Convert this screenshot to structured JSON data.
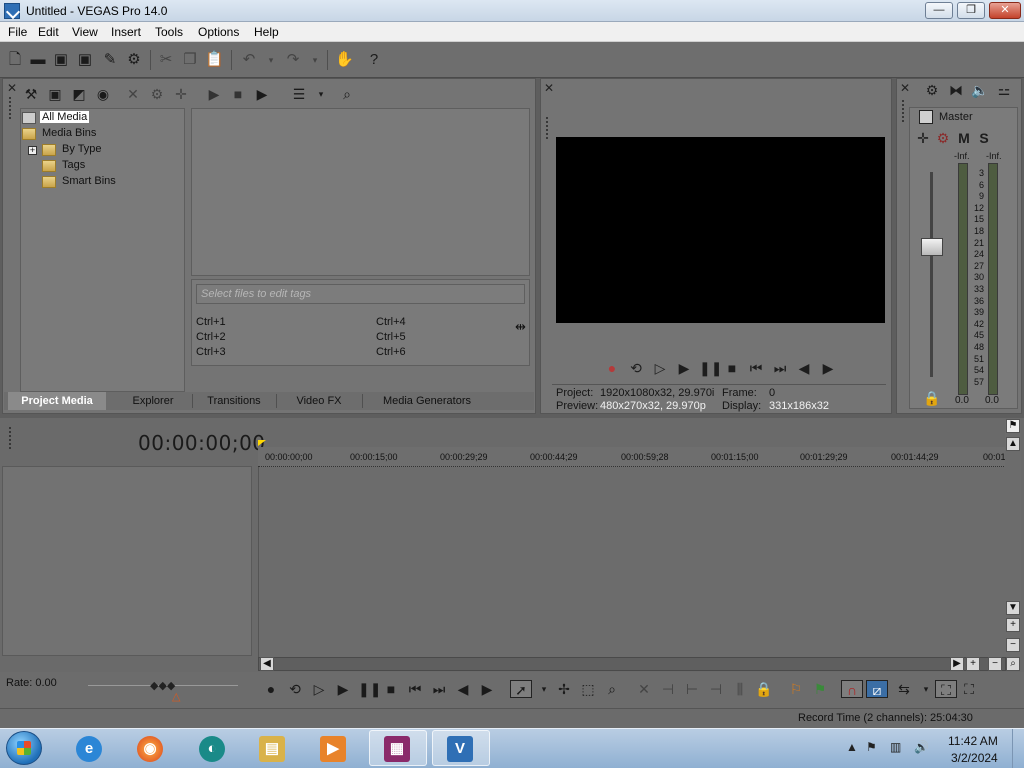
{
  "window": {
    "title": "Untitled - VEGAS Pro 14.0",
    "minimize": "—",
    "maximize": "❐",
    "close": "✕"
  },
  "menu": [
    "File",
    "Edit",
    "View",
    "Insert",
    "Tools",
    "Options",
    "Help"
  ],
  "project_media": {
    "tree": [
      "All Media",
      "Media Bins",
      "By Type",
      "Tags",
      "Smart Bins"
    ],
    "tag_placeholder": "Select files to edit tags",
    "shortcuts": [
      "Ctrl+1",
      "Ctrl+2",
      "Ctrl+3",
      "Ctrl+4",
      "Ctrl+5",
      "Ctrl+6"
    ],
    "expander": "+"
  },
  "tabs": [
    "Project Media",
    "Explorer",
    "Transitions",
    "Video FX",
    "Media Generators"
  ],
  "preview": {
    "project_label": "Project:",
    "project_value": "1920x1080x32, 29.970i",
    "preview_label": "Preview:",
    "preview_value": "480x270x32, 29.970p",
    "frame_label": "Frame:",
    "frame_value": "0",
    "display_label": "Display:",
    "display_value": "331x186x32"
  },
  "mixer": {
    "master_label": "Master",
    "m_label": "M",
    "s_label": "S",
    "peak_left": "-Inf.",
    "peak_right": "-Inf.",
    "scale": [
      "3",
      "6",
      "9",
      "12",
      "15",
      "18",
      "21",
      "24",
      "27",
      "30",
      "33",
      "36",
      "39",
      "42",
      "45",
      "48",
      "51",
      "54",
      "57"
    ],
    "value_left": "0.0",
    "value_right": "0.0"
  },
  "timeline": {
    "timecode": "00:00:00;00",
    "ruler": [
      "00:00:00;00",
      "00:00:15;00",
      "00:00:29;29",
      "00:00:44;29",
      "00:00:59;28",
      "00:01:15;00",
      "00:01:29;29",
      "00:01:44;29",
      "00:01:"
    ],
    "rate": "Rate: 0.00",
    "record_time": "Record Time (2 channels): 25:04:30"
  },
  "taskbar": {
    "time": "11:42 AM",
    "date": "3/2/2024"
  },
  "colors": {
    "accent": "#3b6ea5",
    "record": "#b53a3a",
    "panel": "#747474"
  }
}
